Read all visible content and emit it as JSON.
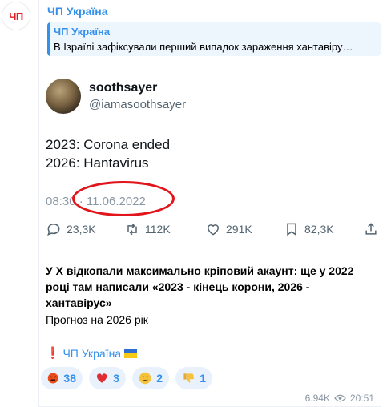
{
  "channel": {
    "avatar_text": "ЧП",
    "name": "ЧП Україна"
  },
  "reply": {
    "title": "ЧП Україна",
    "text": "В Ізраїлі зафіксували перший випадок зараження хантавіру…"
  },
  "tweet": {
    "name": "soothsayer",
    "handle": "@iamasoothsayer",
    "line1": "2023: Corona ended",
    "line2": "2026: Hantavirus",
    "time": "08:30",
    "date": "11.06.2022",
    "replies": "23,3K",
    "retweets": "112K",
    "likes": "291K",
    "bookmarks": "82,3K"
  },
  "post": {
    "text": "У Х відкопали максимально кріповий акаунт: ще у 2022 році там написали «2023 - кінець корони, 2026 - хантавірус»",
    "line2": "Прогноз на 2026 рік",
    "signature": "ЧП Україна"
  },
  "reactions": [
    {
      "emoji": "angry-face-icon",
      "count": "38"
    },
    {
      "emoji": "red-heart-icon",
      "count": "3"
    },
    {
      "emoji": "crying-face-icon",
      "count": "2"
    },
    {
      "emoji": "thumbs-down-icon",
      "count": "1"
    }
  ],
  "meta": {
    "views": "6.94K",
    "time": "20:51"
  },
  "colors": {
    "accent": "#3390ec",
    "brand_red": "#e11b22",
    "reaction_bg": "#e9f2fc"
  }
}
